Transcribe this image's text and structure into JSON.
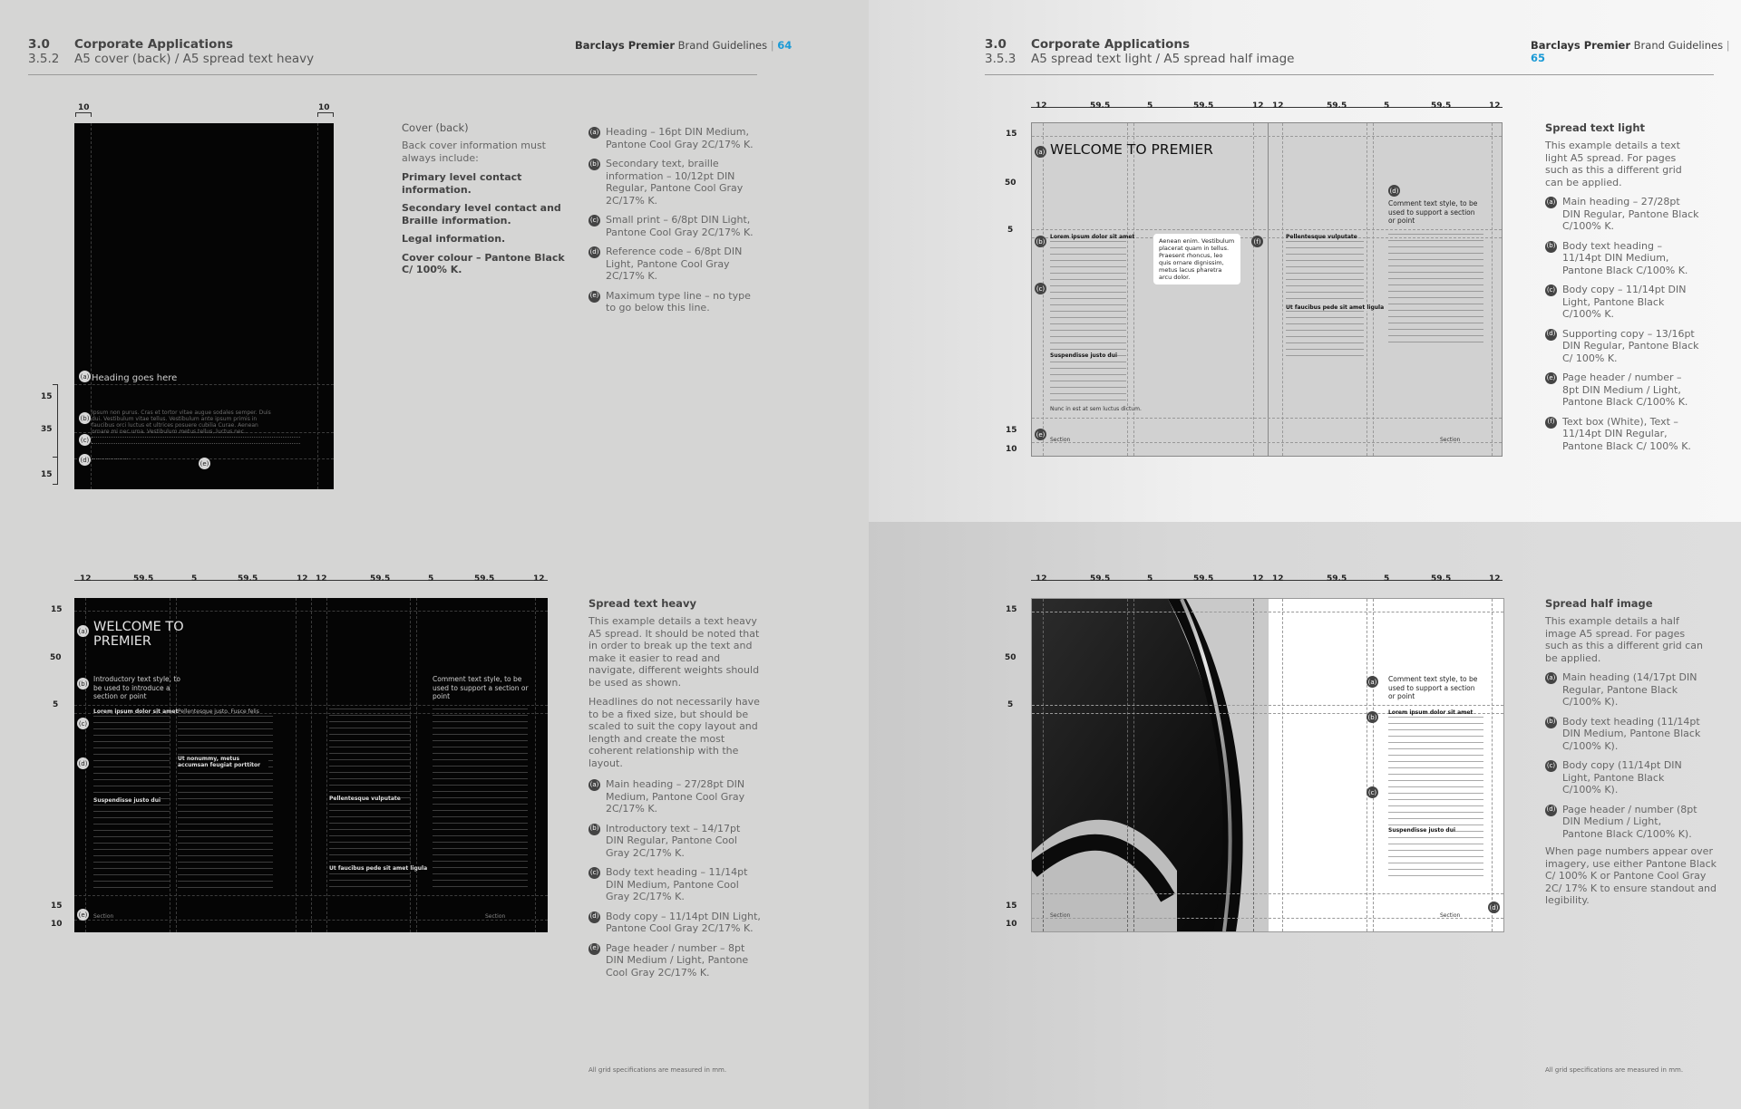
{
  "left_page": {
    "section_num": "3.0",
    "subsection_num": "3.5.2",
    "section_title": "Corporate Applications",
    "subsection_title": "A5 cover (back) / A5 spread text heavy",
    "brand": "Barclays Premier",
    "brand_suffix": "Brand Guidelines",
    "page_number": "64",
    "cover": {
      "dim_top_left": "10",
      "dim_top_right": "10",
      "dim_15a": "15",
      "dim_35": "35",
      "dim_15b": "15",
      "heading": "Heading goes here",
      "marker_a": "(a)",
      "marker_b": "(b)",
      "marker_c": "(c)",
      "marker_d": "(d)",
      "marker_e": "(e)",
      "lorem": "Ipsum non purus. Cras et tortor vitae augue sodales semper. Duis dui. Vestibulum vitae tellus. Vestibulum ante ipsum primis in faucibus orci luctus et ultrices posuere cubilia Curae. Aenean ornare mi nec urna. Vestibulum metus tellus, luctus nec."
    },
    "cover_info": {
      "title": "Cover (back)",
      "intro": "Back cover information must always include:",
      "b1": "Primary level contact information.",
      "b2": "Secondary level contact and Braille information.",
      "b3": "Legal information.",
      "b4": "Cover colour – Pantone Black C/ 100% K."
    },
    "cover_specs": [
      {
        "m": "(a)",
        "t": "Heading – 16pt DIN Medium, Pantone Cool Gray 2C/17% K."
      },
      {
        "m": "(b)",
        "t": "Secondary text, braille information – 10/12pt DIN Regular,  Pantone Cool Gray 2C/17% K."
      },
      {
        "m": "(c)",
        "t": "Small print – 6/8pt DIN Light, Pantone Cool Gray 2C/17% K."
      },
      {
        "m": "(d)",
        "t": "Reference code – 6/8pt DIN Light, Pantone Cool Gray 2C/17% K."
      },
      {
        "m": "(e)",
        "t": "Maximum type line – no type to go below this line."
      }
    ],
    "spread": {
      "cols": [
        "12",
        "59.5",
        "5",
        "59.5",
        "12",
        "12",
        "59.5",
        "5",
        "59.5",
        "12"
      ],
      "rows": [
        "15",
        "50",
        "5",
        "15",
        "10"
      ],
      "title": "WELCOME TO PREMIER",
      "intro": "Introductory text style, to be used to introduce a section or point",
      "comment": "Comment text style, to be used to support a section or point",
      "h1": "Lorem ipsum dolor sit amet",
      "h2": "Suspendisse justo dui",
      "h3": "Pellentesque justo. Fusce felis",
      "h4": "Ut nonummy, metus accumsan feugiat porttitor",
      "h5": "Pellentesque vulputate",
      "h6": "Ut faucibus pede sit amet ligula",
      "footer_left": "Section",
      "footer_right": "Section",
      "m_a": "(a)",
      "m_b": "(b)",
      "m_c": "(c)",
      "m_d": "(d)",
      "m_e": "(e)"
    },
    "spread_info": {
      "title": "Spread text heavy",
      "p1": "This example details a text heavy A5 spread. It should be noted that in order to break up the text and make it easier to read and navigate, different weights should be used as shown.",
      "p2": "Headlines do not necessarily have to be a fixed size, but should be scaled to suit the copy layout and length and create the most coherent relationship with the layout."
    },
    "spread_specs": [
      {
        "m": "(a)",
        "t": "Main heading – 27/28pt DIN Medium, Pantone Cool Gray 2C/17% K."
      },
      {
        "m": "(b)",
        "t": "Introductory text – 14/17pt DIN Regular, Pantone Cool Gray 2C/17% K."
      },
      {
        "m": "(c)",
        "t": "Body text heading – 11/14pt DIN Medium, Pantone Cool Gray 2C/17% K."
      },
      {
        "m": "(d)",
        "t": "Body copy – 11/14pt DIN Light, Pantone Cool Gray 2C/17% K."
      },
      {
        "m": "(e)",
        "t": "Page header / number – 8pt DIN Medium / Light, Pantone Cool Gray 2C/17% K."
      }
    ],
    "footnote": "All grid specifications are measured in mm."
  },
  "right_page": {
    "section_num": "3.0",
    "subsection_num": "3.5.3",
    "section_title": "Corporate Applications",
    "subsection_title": "A5 spread text light / A5 spread half image",
    "brand": "Barclays Premier",
    "brand_suffix": "Brand Guidelines",
    "page_number": "65",
    "light": {
      "cols": [
        "12",
        "59.5",
        "5",
        "59.5",
        "12",
        "12",
        "59.5",
        "5",
        "59.5",
        "12"
      ],
      "rows": [
        "15",
        "50",
        "5",
        "15",
        "10"
      ],
      "title": "WELCOME TO PREMIER",
      "comment": "Comment text style, to be used to support a section or point",
      "textbox": "Aenean enim. Vestibulum placerat quam in tellus. Praesent rhoncus, leo quis ornare dignissim, metus lacus pharetra arcu dolor.",
      "h1": "Lorem ipsum dolor sit amet",
      "h2": "Suspendisse justo dui",
      "h3": "Pellentesque vulputate",
      "h4": "Ut faucibus pede sit amet ligula",
      "last": "Nunc in est at sem luctus dictum.",
      "footer_left": "Section",
      "footer_right": "Section",
      "m_a": "(a)",
      "m_b": "(b)",
      "m_c": "(c)",
      "m_d": "(d)",
      "m_e": "(e)",
      "m_f": "(f)"
    },
    "light_info": {
      "title": "Spread text light",
      "p1": "This example details a text light A5 spread. For pages such as this a different grid can be applied."
    },
    "light_specs": [
      {
        "m": "(a)",
        "t": "Main heading – 27/28pt DIN Regular, Pantone Black C/100% K."
      },
      {
        "m": "(b)",
        "t": "Body text heading – 11/14pt DIN Medium, Pantone Black C/100% K."
      },
      {
        "m": "(c)",
        "t": "Body copy – 11/14pt DIN Light, Pantone Black C/100% K."
      },
      {
        "m": "(d)",
        "t": "Supporting copy – 13/16pt DIN Regular, Pantone Black C/ 100% K."
      },
      {
        "m": "(e)",
        "t": "Page header / number – 8pt DIN Medium / Light, Pantone Black C/100% K."
      },
      {
        "m": "(f)",
        "t": "Text box (White), Text – 11/14pt DIN Regular, Pantone Black C/ 100% K."
      }
    ],
    "half": {
      "cols": [
        "12",
        "59.5",
        "5",
        "59.5",
        "12",
        "12",
        "59.5",
        "5",
        "59.5",
        "12"
      ],
      "rows": [
        "15",
        "50",
        "5",
        "15",
        "10"
      ],
      "comment": "Comment text style, to be used to support a section or point",
      "h1": "Lorem ipsum dolor sit amet",
      "h2": "Suspendisse justo dui",
      "footer_left": "Section",
      "footer_right": "Section",
      "m_a": "(a)",
      "m_b": "(b)",
      "m_c": "(c)",
      "m_d": "(d)"
    },
    "half_info": {
      "title": "Spread half image",
      "p1": "This example details a half image A5 spread. For pages such as this a different grid can be applied.",
      "p2": "When page numbers appear over imagery, use either Pantone Black C/ 100% K or Pantone Cool Gray 2C/ 17% K to ensure standout and legibility."
    },
    "half_specs": [
      {
        "m": "(a)",
        "t": "Main heading (14/17pt DIN Regular, Pantone Black C/100% K)."
      },
      {
        "m": "(b)",
        "t": "Body text heading (11/14pt DIN Medium, Pantone Black C/100% K)."
      },
      {
        "m": "(c)",
        "t": "Body copy (11/14pt DIN Light, Pantone Black C/100% K)."
      },
      {
        "m": "(d)",
        "t": "Page header / number (8pt DIN Medium / Light, Pantone Black C/100% K)."
      }
    ],
    "footnote": "All grid specifications are measured in mm."
  }
}
